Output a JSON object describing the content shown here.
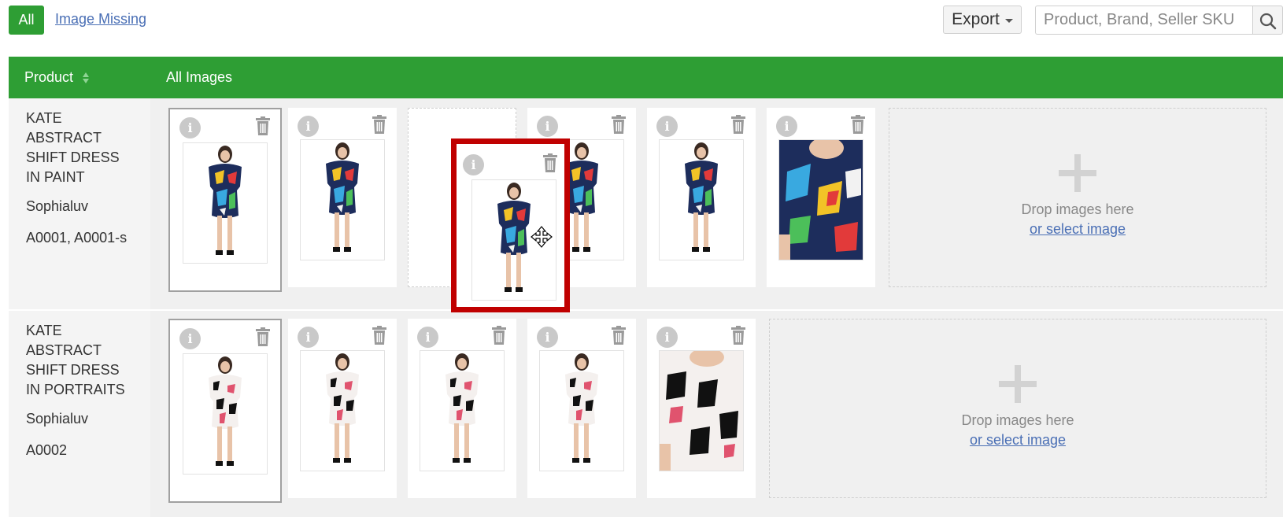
{
  "toolbar": {
    "filter_all": "All",
    "filter_missing": "Image Missing",
    "export_label": "Export",
    "search_placeholder": "Product, Brand, Seller SKU"
  },
  "table": {
    "col_product": "Product",
    "col_images": "All Images"
  },
  "products": [
    {
      "name": "KATE ABSTRACT SHIFT DRESS IN PAINT",
      "brand": "Sophialuv",
      "sku": "A0001, A0001-s",
      "image_count": 6,
      "drop_text": "Drop images here",
      "select_text": "or select image"
    },
    {
      "name": "KATE ABSTRACT SHIFT DRESS IN PORTRAITS",
      "brand": "Sophialuv",
      "sku": "A0002",
      "image_count": 5,
      "drop_text": "Drop images here",
      "select_text": "or select image"
    }
  ],
  "colors": {
    "accent": "#2e9e34",
    "drag_highlight": "#c00000",
    "link": "#4a6fb5"
  },
  "icons": [
    "info-icon",
    "trash-icon",
    "search-icon",
    "move-cursor-icon",
    "plus-icon",
    "sort-icon",
    "caret-down-icon"
  ]
}
